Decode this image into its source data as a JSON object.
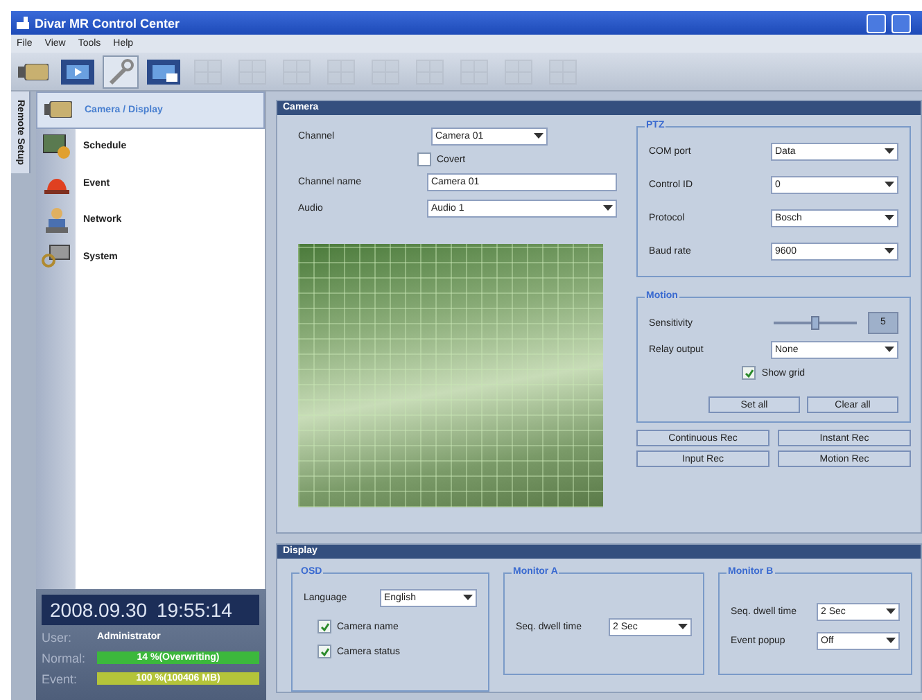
{
  "window": {
    "title": "Divar MR Control Center"
  },
  "menu": [
    "File",
    "View",
    "Tools",
    "Help"
  ],
  "toolbar": [
    {
      "kind": "camera",
      "selected": false,
      "disabled": false
    },
    {
      "kind": "film",
      "selected": false,
      "disabled": false
    },
    {
      "kind": "wrench",
      "selected": true,
      "disabled": false
    },
    {
      "kind": "playback",
      "selected": false,
      "disabled": false
    },
    {
      "kind": "layout",
      "selected": false,
      "disabled": true
    },
    {
      "kind": "layout",
      "selected": false,
      "disabled": true
    },
    {
      "kind": "layout",
      "selected": false,
      "disabled": true
    },
    {
      "kind": "layout",
      "selected": false,
      "disabled": true
    },
    {
      "kind": "layout",
      "selected": false,
      "disabled": true
    },
    {
      "kind": "layout",
      "selected": false,
      "disabled": true
    },
    {
      "kind": "layout",
      "selected": false,
      "disabled": true
    },
    {
      "kind": "layout",
      "selected": false,
      "disabled": true
    },
    {
      "kind": "layout",
      "selected": false,
      "disabled": true
    }
  ],
  "side_tab": {
    "label": "Remote Setup",
    "selected": true
  },
  "sidebar": {
    "items": [
      {
        "label": "Camera / Display",
        "kind": "camera",
        "selected": true
      },
      {
        "label": "Schedule",
        "kind": "schedule",
        "selected": false
      },
      {
        "label": "Event",
        "kind": "event",
        "selected": false
      },
      {
        "label": "Network",
        "kind": "network",
        "selected": false
      },
      {
        "label": "System",
        "kind": "system",
        "selected": false
      }
    ]
  },
  "status": {
    "datetime": "2008.09.30 19:55:14",
    "user_label": "User:",
    "user": "Administrator",
    "meters": [
      {
        "label": "Normal:",
        "level": 1,
        "color": "#3cb83c",
        "reading": "14 %(Overwriting)"
      },
      {
        "label": "Event:",
        "level": 1,
        "color": "#b4c43a",
        "reading": "100 %(100406 MB)"
      }
    ]
  },
  "camera": {
    "title": "Camera",
    "channel": {
      "label": "Channel",
      "value": "Camera 01"
    },
    "covert": {
      "label": "Covert",
      "checked": false
    },
    "channel_name": {
      "label": "Channel name",
      "value": "Camera 01"
    },
    "audio": {
      "label": "Audio",
      "value": "Audio 1"
    },
    "ptz": {
      "title": "PTZ",
      "fields": [
        {
          "label": "COM port",
          "value": "Data"
        },
        {
          "label": "Control ID",
          "value": "0"
        },
        {
          "label": "Protocol",
          "value": "Bosch"
        },
        {
          "label": "Baud rate",
          "value": "9600"
        }
      ]
    },
    "motion": {
      "title": "Motion",
      "sensitivity": {
        "label": "Sensitivity",
        "level": 0.5,
        "value": "5"
      },
      "relay_output": {
        "label": "Relay output",
        "value": "None"
      },
      "show_grid": {
        "label": "Show grid",
        "checked": true
      },
      "buttons": [
        "Set all",
        "Clear all"
      ]
    },
    "rec_buttons": [
      "Continuous Rec",
      "Instant Rec",
      "Input Rec",
      "Motion Rec"
    ]
  },
  "display": {
    "title": "Display",
    "osd": {
      "title": "OSD",
      "language": {
        "label": "Language",
        "value": "English"
      },
      "checkboxes": [
        {
          "label": "Camera name",
          "checked": true
        },
        {
          "label": "Camera status",
          "checked": true
        }
      ]
    },
    "monitor_a": {
      "title": "Monitor A",
      "fields": [
        {
          "label": "Seq. dwell time",
          "value": "2 Sec"
        }
      ]
    },
    "monitor_b": {
      "title": "Monitor B",
      "fields": [
        {
          "label": "Seq. dwell time",
          "value": "2 Sec"
        },
        {
          "label": "Event popup",
          "value": "Off"
        }
      ]
    }
  }
}
